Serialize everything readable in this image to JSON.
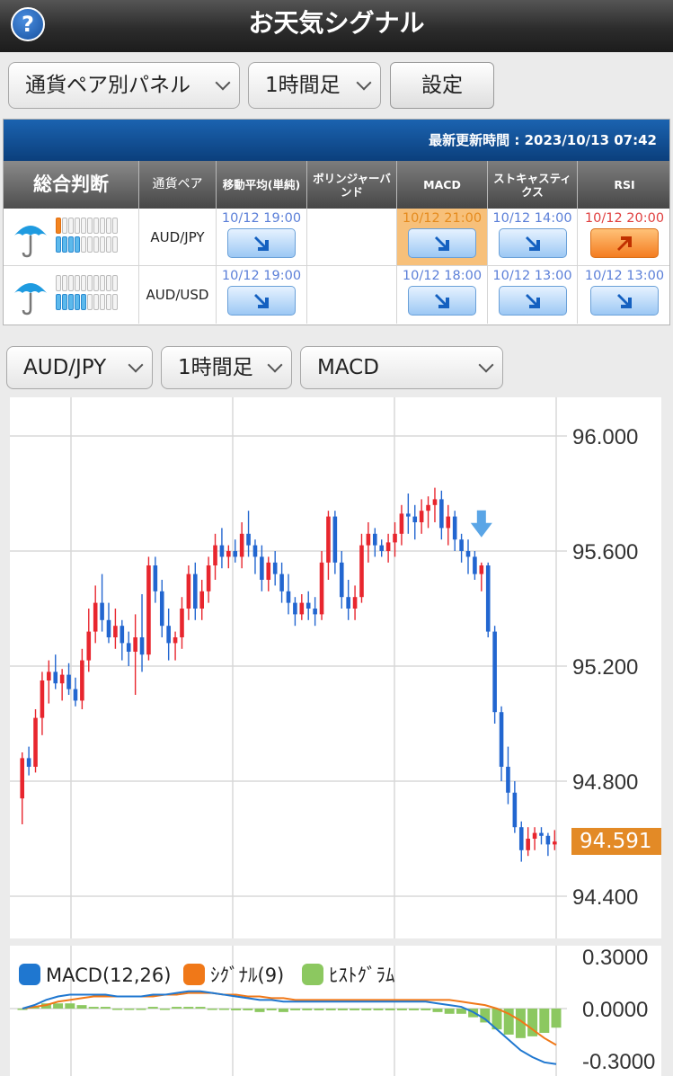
{
  "app": {
    "title": "お天気シグナル",
    "help_icon": "?"
  },
  "controls": {
    "panel_select": "通貨ペア別パネル",
    "timeframe_select": "1時間足",
    "settings_label": "設定"
  },
  "panel": {
    "updated": "最新更新時間 : 2023/10/13 07:42",
    "headers": {
      "overall": "総合判断",
      "pair": "通貨ペア",
      "ma": "移動平均(単純)",
      "bb": "ボリンジャーバンド",
      "macd": "MACD",
      "stoch": "ストキャスティクス",
      "rsi": "RSI"
    },
    "rows": [
      {
        "pair": "AUD/JPY",
        "weather": "rain",
        "meter": {
          "orange": 1,
          "blue_bottom": 4
        },
        "ma": {
          "time": "10/12 19:00",
          "signal": "down"
        },
        "bb": null,
        "macd": {
          "time": "10/12 21:00",
          "signal": "down",
          "highlight": true
        },
        "stoch": {
          "time": "10/12 14:00",
          "signal": "down"
        },
        "rsi": {
          "time": "10/12 20:00",
          "signal": "up"
        }
      },
      {
        "pair": "AUD/USD",
        "weather": "rain",
        "meter": {
          "orange": 0,
          "blue_bottom": 5
        },
        "ma": {
          "time": "10/12 19:00",
          "signal": "down"
        },
        "bb": null,
        "macd": {
          "time": "10/12 18:00",
          "signal": "down",
          "highlight": false
        },
        "stoch": {
          "time": "10/12 13:00",
          "signal": "down"
        },
        "rsi": {
          "time": "10/12 13:00",
          "signal": "down"
        }
      }
    ]
  },
  "chart_controls": {
    "pair_select": "AUD/JPY",
    "timeframe_select": "1時間足",
    "indicator_select": "MACD"
  },
  "colors": {
    "up": "#e8262e",
    "down": "#2266d0",
    "macd": "#1f77d0",
    "signal": "#f07818",
    "histogram": "#8cc860",
    "signal_arrow": "#5aa5e6",
    "price_badge": "#e38a26"
  },
  "chart_data": [
    {
      "type": "candlestick",
      "symbol": "AUD/JPY",
      "ylim": [
        94.3,
        96.1
      ],
      "yticks": [
        "96.000",
        "95.600",
        "95.200",
        "94.800",
        "94.400"
      ],
      "grid": true,
      "current_price": "94.591",
      "signal_marker": {
        "candle": 69,
        "direction": "down"
      },
      "candles": [
        [
          94.74,
          94.9,
          94.65,
          94.88
        ],
        [
          94.88,
          94.92,
          94.82,
          94.85
        ],
        [
          94.85,
          95.05,
          94.83,
          95.02
        ],
        [
          95.02,
          95.18,
          94.96,
          95.15
        ],
        [
          95.15,
          95.22,
          95.07,
          95.18
        ],
        [
          95.18,
          95.24,
          95.12,
          95.14
        ],
        [
          95.14,
          95.19,
          95.08,
          95.17
        ],
        [
          95.17,
          95.21,
          95.1,
          95.12
        ],
        [
          95.12,
          95.16,
          95.06,
          95.08
        ],
        [
          95.08,
          95.26,
          95.05,
          95.22
        ],
        [
          95.22,
          95.4,
          95.18,
          95.32
        ],
        [
          95.32,
          95.48,
          95.28,
          95.42
        ],
        [
          95.42,
          95.52,
          95.32,
          95.36
        ],
        [
          95.36,
          95.42,
          95.28,
          95.3
        ],
        [
          95.3,
          95.4,
          95.26,
          95.34
        ],
        [
          95.34,
          95.36,
          95.22,
          95.28
        ],
        [
          95.28,
          95.32,
          95.2,
          95.25
        ],
        [
          95.25,
          95.38,
          95.1,
          95.3
        ],
        [
          95.3,
          95.45,
          95.18,
          95.24
        ],
        [
          95.24,
          95.58,
          95.22,
          95.55
        ],
        [
          95.55,
          95.58,
          95.42,
          95.46
        ],
        [
          95.46,
          95.5,
          95.3,
          95.34
        ],
        [
          95.34,
          95.4,
          95.22,
          95.28
        ],
        [
          95.28,
          95.32,
          95.22,
          95.3
        ],
        [
          95.3,
          95.44,
          95.26,
          95.4
        ],
        [
          95.4,
          95.55,
          95.36,
          95.52
        ],
        [
          95.52,
          95.56,
          95.36,
          95.4
        ],
        [
          95.4,
          95.5,
          95.36,
          95.46
        ],
        [
          95.46,
          95.58,
          95.42,
          95.55
        ],
        [
          95.55,
          95.66,
          95.5,
          95.62
        ],
        [
          95.62,
          95.68,
          95.54,
          95.58
        ],
        [
          95.58,
          95.62,
          95.54,
          95.6
        ],
        [
          95.6,
          95.64,
          95.56,
          95.58
        ],
        [
          95.58,
          95.7,
          95.54,
          95.66
        ],
        [
          95.66,
          95.74,
          95.58,
          95.62
        ],
        [
          95.62,
          95.64,
          95.52,
          95.58
        ],
        [
          95.58,
          95.62,
          95.46,
          95.5
        ],
        [
          95.5,
          95.58,
          95.46,
          95.56
        ],
        [
          95.56,
          95.6,
          95.48,
          95.52
        ],
        [
          95.52,
          95.56,
          95.42,
          95.46
        ],
        [
          95.46,
          95.52,
          95.38,
          95.42
        ],
        [
          95.42,
          95.44,
          95.34,
          95.38
        ],
        [
          95.38,
          95.45,
          95.36,
          95.42
        ],
        [
          95.42,
          95.46,
          95.36,
          95.4
        ],
        [
          95.4,
          95.44,
          95.34,
          95.38
        ],
        [
          95.38,
          95.6,
          95.36,
          95.56
        ],
        [
          95.56,
          95.74,
          95.5,
          95.72
        ],
        [
          95.72,
          95.74,
          95.52,
          95.56
        ],
        [
          95.56,
          95.6,
          95.4,
          95.44
        ],
        [
          95.44,
          95.5,
          95.36,
          95.4
        ],
        [
          95.4,
          95.48,
          95.36,
          95.44
        ],
        [
          95.44,
          95.66,
          95.42,
          95.62
        ],
        [
          95.62,
          95.7,
          95.56,
          95.66
        ],
        [
          95.66,
          95.68,
          95.58,
          95.62
        ],
        [
          95.62,
          95.64,
          95.58,
          95.6
        ],
        [
          95.6,
          95.66,
          95.56,
          95.63
        ],
        [
          95.63,
          95.7,
          95.58,
          95.66
        ],
        [
          95.66,
          95.76,
          95.62,
          95.73
        ],
        [
          95.73,
          95.8,
          95.66,
          95.72
        ],
        [
          95.72,
          95.76,
          95.64,
          95.7
        ],
        [
          95.7,
          95.78,
          95.66,
          95.74
        ],
        [
          95.74,
          95.79,
          95.68,
          95.76
        ],
        [
          95.76,
          95.82,
          95.7,
          95.78
        ],
        [
          95.78,
          95.81,
          95.64,
          95.68
        ],
        [
          95.68,
          95.76,
          95.62,
          95.72
        ],
        [
          95.72,
          95.74,
          95.6,
          95.64
        ],
        [
          95.64,
          95.66,
          95.56,
          95.6
        ],
        [
          95.6,
          95.64,
          95.52,
          95.58
        ],
        [
          95.58,
          95.6,
          95.5,
          95.52
        ],
        [
          95.52,
          95.56,
          95.46,
          95.55
        ],
        [
          95.55,
          95.56,
          95.3,
          95.32
        ],
        [
          95.32,
          95.34,
          95.0,
          95.04
        ],
        [
          95.04,
          95.06,
          94.8,
          94.85
        ],
        [
          94.85,
          94.92,
          94.72,
          94.76
        ],
        [
          94.76,
          94.8,
          94.62,
          94.64
        ],
        [
          94.64,
          94.66,
          94.52,
          94.56
        ],
        [
          94.56,
          94.64,
          94.54,
          94.6
        ],
        [
          94.6,
          94.64,
          94.56,
          94.62
        ],
        [
          94.62,
          94.64,
          94.58,
          94.61
        ],
        [
          94.61,
          94.62,
          94.54,
          94.58
        ],
        [
          94.58,
          94.63,
          94.56,
          94.59
        ]
      ]
    },
    {
      "type": "line",
      "title": "MACD",
      "ylim": [
        -0.33,
        0.33
      ],
      "yticks": [
        "0.3000",
        "0.0000",
        "-0.3000"
      ],
      "legend": [
        "MACD(12,26)",
        "ｼｸﾞﾅﾙ(9)",
        "ﾋｽﾄｸﾞﾗﾑ"
      ],
      "series": [
        {
          "name": "MACD(12,26)",
          "values": [
            0.0,
            0.02,
            0.05,
            0.07,
            0.08,
            0.08,
            0.08,
            0.08,
            0.07,
            0.07,
            0.07,
            0.08,
            0.08,
            0.09,
            0.1,
            0.1,
            0.09,
            0.08,
            0.07,
            0.06,
            0.05,
            0.05,
            0.04,
            0.04,
            0.04,
            0.04,
            0.04,
            0.04,
            0.04,
            0.04,
            0.04,
            0.04,
            0.04,
            0.04,
            0.04,
            0.03,
            0.02,
            0.01,
            -0.02,
            -0.06,
            -0.12,
            -0.18,
            -0.24,
            -0.28,
            -0.31,
            -0.32
          ]
        },
        {
          "name": "ｼｸﾞﾅﾙ(9)",
          "values": [
            0.0,
            0.01,
            0.02,
            0.04,
            0.05,
            0.06,
            0.07,
            0.07,
            0.07,
            0.07,
            0.07,
            0.07,
            0.08,
            0.08,
            0.09,
            0.09,
            0.09,
            0.08,
            0.08,
            0.07,
            0.07,
            0.06,
            0.06,
            0.05,
            0.05,
            0.05,
            0.05,
            0.05,
            0.05,
            0.05,
            0.05,
            0.05,
            0.05,
            0.05,
            0.05,
            0.05,
            0.05,
            0.04,
            0.03,
            0.02,
            0.0,
            -0.03,
            -0.07,
            -0.12,
            -0.17,
            -0.21
          ]
        },
        {
          "name": "ﾋｽﾄｸﾞﾗﾑ",
          "values": [
            0.0,
            0.01,
            0.03,
            0.03,
            0.03,
            0.02,
            0.01,
            0.01,
            0.0,
            0.0,
            0.0,
            0.01,
            0.0,
            0.01,
            0.01,
            0.01,
            0.0,
            0.0,
            -0.01,
            -0.01,
            -0.02,
            -0.01,
            -0.02,
            -0.01,
            -0.01,
            -0.01,
            -0.01,
            -0.01,
            -0.01,
            -0.01,
            -0.01,
            -0.01,
            -0.01,
            -0.01,
            -0.01,
            -0.02,
            -0.03,
            -0.03,
            -0.05,
            -0.08,
            -0.12,
            -0.15,
            -0.17,
            -0.16,
            -0.14,
            -0.11
          ]
        }
      ]
    }
  ]
}
